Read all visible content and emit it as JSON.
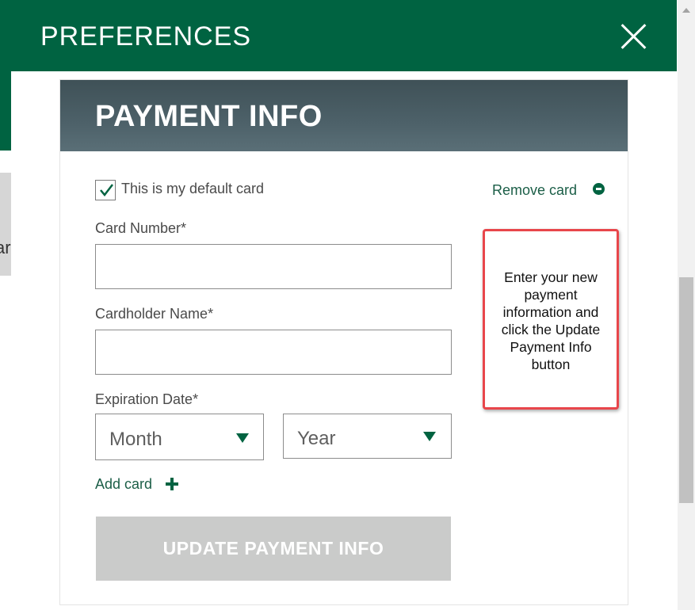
{
  "background": {
    "partial_text": "ar"
  },
  "modal": {
    "title": "PREFERENCES"
  },
  "payment": {
    "title": "PAYMENT INFO",
    "default_card_label": "This is my default card",
    "default_card_checked": true,
    "remove_card_label": "Remove card",
    "card_number_label": "Card Number*",
    "card_number_value": "",
    "cardholder_name_label": "Cardholder Name*",
    "cardholder_name_value": "",
    "expiration_label": "Expiration Date*",
    "month_value": "Month",
    "year_value": "Year",
    "add_card_label": "Add card",
    "update_button_label": "UPDATE PAYMENT INFO"
  },
  "callout": {
    "text": "Enter your new payment information and click the Update Payment Info button"
  },
  "colors": {
    "brand_green": "#006341",
    "header_slate": "#4d6169",
    "button_disabled": "#cacbca",
    "callout_border": "#e8464b"
  },
  "icons": {
    "close": "close-icon",
    "checkmark": "checkmark-icon",
    "remove": "minus-circle-icon",
    "dropdown": "chevron-down-icon",
    "add": "plus-icon"
  }
}
